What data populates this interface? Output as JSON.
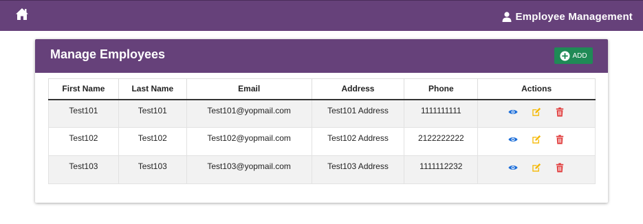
{
  "nav": {
    "brand_title": "Employee Management",
    "home_icon": "home-icon",
    "user_icon": "user-icon",
    "color": "#66417a"
  },
  "card": {
    "title": "Manage Employees",
    "add_label": "ADD",
    "add_color": "#1f8a56"
  },
  "table": {
    "headers": [
      "First Name",
      "Last Name",
      "Email",
      "Address",
      "Phone",
      "Actions"
    ],
    "rows": [
      {
        "first_name": "Test101",
        "last_name": "Test101",
        "email": "Test101@yopmail.com",
        "address": "Test101 Address",
        "phone": "1111111111"
      },
      {
        "first_name": "Test102",
        "last_name": "Test102",
        "email": "Test102@yopmail.com",
        "address": "Test102 Address",
        "phone": "2122222222"
      },
      {
        "first_name": "Test103",
        "last_name": "Test103",
        "email": "Test103@yopmail.com",
        "address": "Test103 Address",
        "phone": "1111112232"
      }
    ],
    "action_icons": [
      "eye-icon",
      "edit-icon",
      "trash-icon"
    ],
    "action_colors": {
      "view": "#1e6fd9",
      "edit": "#f5b800",
      "delete": "#e03a3a"
    }
  }
}
